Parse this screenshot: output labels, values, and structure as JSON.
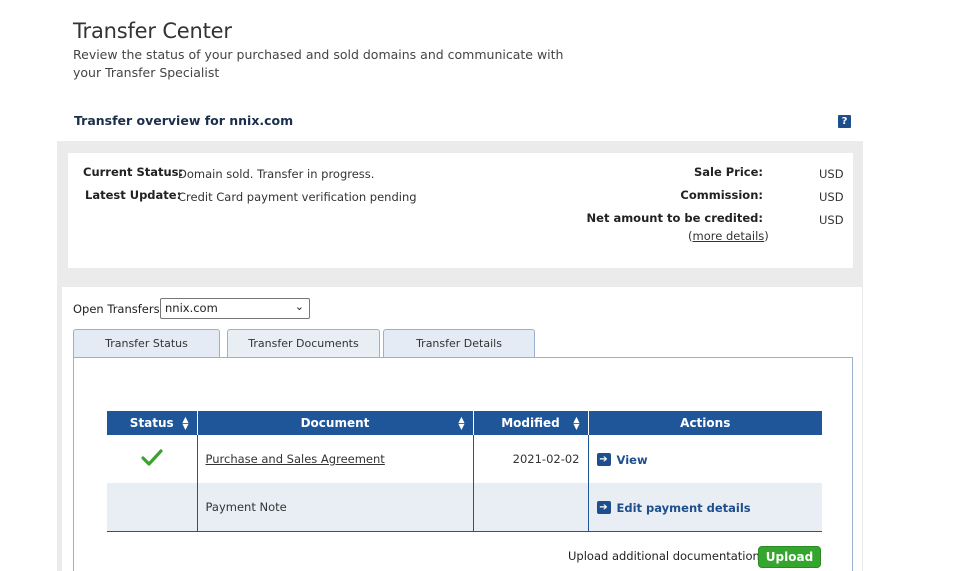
{
  "header": {
    "title": "Transfer Center",
    "subtitle": "Review the status of your purchased and sold domains and communicate with your Transfer Specialist"
  },
  "overview": {
    "heading": "Transfer overview for nnix.com",
    "help_icon": "?"
  },
  "summary": {
    "current_status_label": "Current Status:",
    "current_status_value": "Domain sold. Transfer in progress.",
    "latest_update_label": "Latest Update:",
    "latest_update_value": "Credit Card payment verification pending",
    "sale_price_label": "Sale Price:",
    "commission_label": "Commission:",
    "net_amount_label": "Net amount to be credited:",
    "currency": "USD",
    "more_details_open": "(",
    "more_details_link": "more details",
    "more_details_close": ")"
  },
  "open_transfers": {
    "label": "Open Transfers:",
    "selected": "nnix.com"
  },
  "tabs": [
    {
      "label": "Transfer Status"
    },
    {
      "label": "Transfer Documents",
      "active": true
    },
    {
      "label": "Transfer Details"
    }
  ],
  "table": {
    "headers": [
      "Status",
      "Document",
      "Modified",
      "Actions"
    ],
    "rows": [
      {
        "status_icon": "checkmark-icon",
        "document": "Purchase and Sales Agreement",
        "modified": "2021-02-02",
        "action": "View"
      },
      {
        "status_icon": "",
        "document": "Payment Note",
        "modified": "",
        "action": "Edit payment details"
      }
    ]
  },
  "upload": {
    "label": "Upload additional documentation:",
    "button": "Upload"
  },
  "colors": {
    "header_blue": "#1f5699",
    "link_blue": "#1f4e8c",
    "upload_green": "#35a62d",
    "check_green": "#3aa32e"
  }
}
